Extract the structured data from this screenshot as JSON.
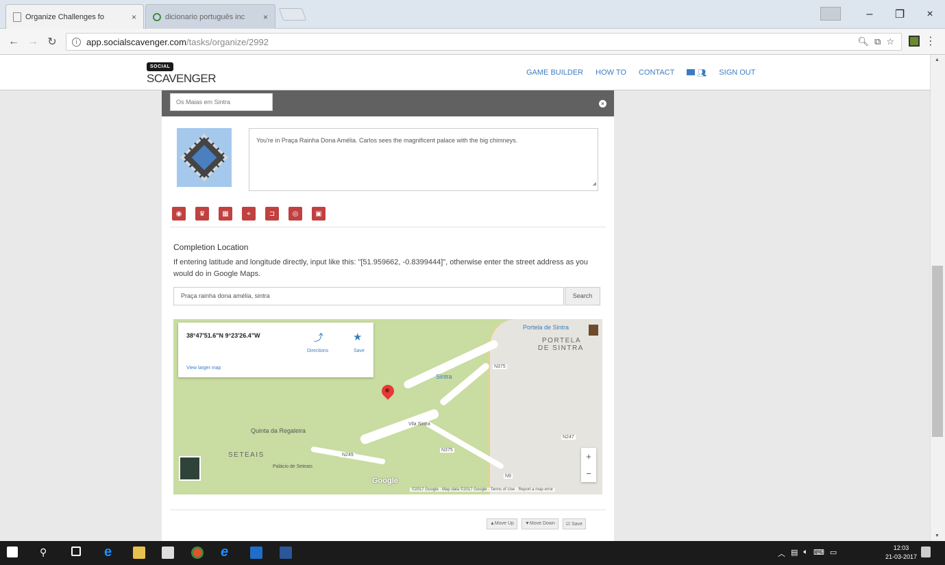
{
  "browser": {
    "tabs": [
      {
        "title": "Organize Challenges fo",
        "close": "×"
      },
      {
        "title": "dicionario português inc",
        "close": "×"
      }
    ],
    "url_host": "app.socialscavenger.com",
    "url_path": "/tasks/organize/2992",
    "window_controls": {
      "minimize": "–",
      "maximize": "❐",
      "close": "×"
    }
  },
  "site": {
    "logo_top": "SOCIAL",
    "logo_main": "SCAVENGER",
    "nav": [
      "GAME BUILDER",
      "HOW TO",
      "CONTACT",
      "SIGN OUT"
    ]
  },
  "task": {
    "title_value": "Os Maias em Sintra",
    "description": "You're in Praça Rainha Dona Amélia.  Carlos sees the magnificent palace with the big chimneys.",
    "icon_buttons": [
      "camera-icon",
      "trophy-icon",
      "calendar-icon",
      "map-marker-icon",
      "unlock-icon",
      "eye-icon",
      "photo-icon"
    ]
  },
  "completion": {
    "title": "Completion Location",
    "help": "If entering latitude and longitude directly, input like this: \"[51.959662, -0.8399444]\", otherwise enter the street address as you would do in Google Maps.",
    "search_value": "Praça rainha dona amélia, sintra",
    "search_button": "Search"
  },
  "map": {
    "coords": "38°47'51.6\"N 9°23'26.4\"W",
    "directions_label": "Directions",
    "save_label": "Save",
    "larger_map": "View larger map",
    "labels": {
      "portela": "PORTELA",
      "de_sintra": "DE SINTRA",
      "quinta": "Quinta da Regaleira",
      "seteais": "SETEAIS",
      "palace": "Palácio de Seteais",
      "sintra": "Sintra",
      "vila_sintra": "Vila Sintra",
      "estacao": "Portela de Sintra",
      "road_1": "N375",
      "road_2": "N247",
      "road_3": "N249",
      "road_4": "N375",
      "road_5": "N9"
    },
    "google": "Google",
    "attribution": "©2017 Google · Map data ©2017 Google · Terms of Use · Report a map error",
    "zoom_in": "+",
    "zoom_out": "−"
  },
  "footer": {
    "move_up": "▲Move Up",
    "move_down": "▼Move Down",
    "save": "☑ Save"
  },
  "taskbar": {
    "time": "12:03",
    "date": "21-03-2017"
  }
}
